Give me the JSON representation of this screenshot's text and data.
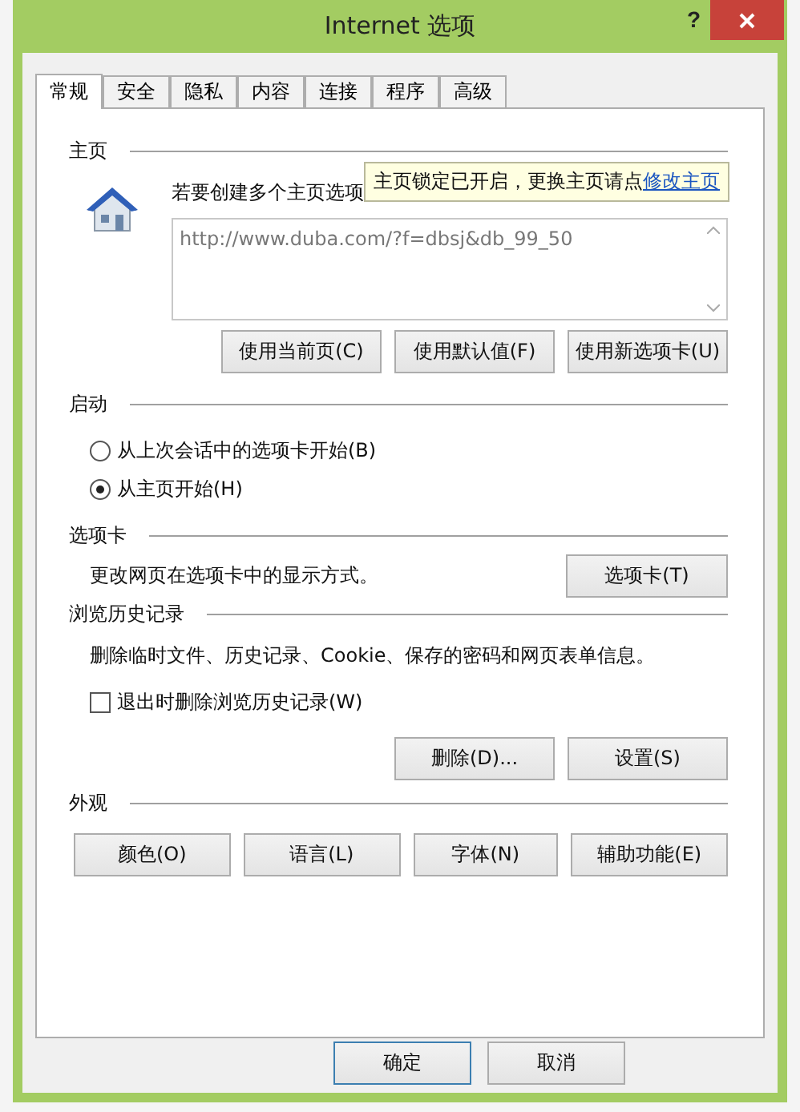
{
  "window": {
    "title": "Internet 选项",
    "help": "?"
  },
  "tabs": [
    {
      "label": "常规",
      "selected": true
    },
    {
      "label": "安全",
      "selected": false
    },
    {
      "label": "隐私",
      "selected": false
    },
    {
      "label": "内容",
      "selected": false
    },
    {
      "label": "连接",
      "selected": false
    },
    {
      "label": "程序",
      "selected": false
    },
    {
      "label": "高级",
      "selected": false
    }
  ],
  "home_page": {
    "heading": "主页",
    "description": "若要创建多个主页选项",
    "tooltip": {
      "text": "主页锁定已开启，更换主页请点",
      "link": "修改主页"
    },
    "urls": "http://www.duba.com/?f=dbsj&db_99_50",
    "buttons": [
      "使用当前页(C)",
      "使用默认值(F)",
      "使用新选项卡(U)"
    ]
  },
  "startup": {
    "heading": "启动",
    "options": [
      {
        "label": "从上次会话中的选项卡开始(B)",
        "selected": false
      },
      {
        "label": "从主页开始(H)",
        "selected": true
      }
    ]
  },
  "tabs_section": {
    "heading": "选项卡",
    "description": "更改网页在选项卡中的显示方式。",
    "button": "选项卡(T)"
  },
  "history": {
    "heading": "浏览历史记录",
    "description": "删除临时文件、历史记录、Cookie、保存的密码和网页表单信息。",
    "checkbox": {
      "label": "退出时删除浏览历史记录(W)",
      "checked": false
    },
    "buttons": [
      "删除(D)...",
      "设置(S)"
    ]
  },
  "appearance": {
    "heading": "外观",
    "buttons": [
      "颜色(O)",
      "语言(L)",
      "字体(N)",
      "辅助功能(E)"
    ]
  },
  "footer_buttons": [
    {
      "label": "确定",
      "default": true
    },
    {
      "label": "取消",
      "default": false
    }
  ]
}
